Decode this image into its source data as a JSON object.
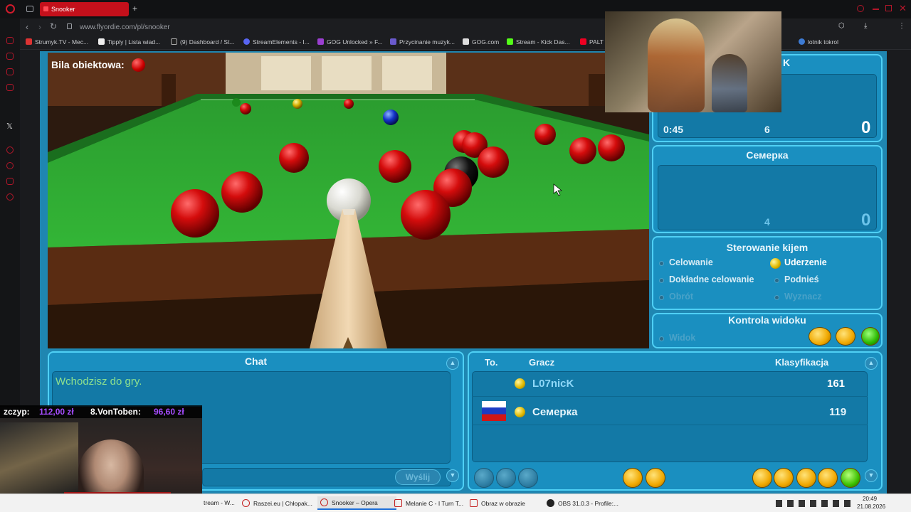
{
  "browser": {
    "tab_title": "Snooker",
    "new_tab": "+",
    "url": "www.flyordie.com/pl/snooker",
    "bookmarks": [
      "Strumyk.TV - Mec...",
      "Tipply | Lista wiad...",
      "(9) Dashboard / St...",
      "StreamElements - I...",
      "GOG Unlocked » F...",
      "Przycinanie muzyk...",
      "GOG.com",
      "Stream - Kick Das...",
      "PALT",
      "lotnik tokrol"
    ]
  },
  "game": {
    "object_ball_label": "Bila obiektowa:",
    "player1_panel": {
      "time": "0:45",
      "count": "6",
      "score": "0",
      "name_fragment": "K"
    },
    "player2_panel": {
      "name": "Семерка",
      "count": "4",
      "score": "0"
    },
    "cue_control": {
      "title": "Sterowanie kijem",
      "options": [
        "Celowanie",
        "Uderzenie",
        "Dokładne celowanie",
        "Podnieś",
        "Obrót",
        "Wyznacz"
      ],
      "selected": "Uderzenie"
    },
    "view_control": {
      "title": "Kontrola widoku",
      "option": "Widok"
    },
    "chat": {
      "title": "Chat",
      "message": "Wchodzisz do gry.",
      "send_label": "Wyślij"
    },
    "players_table": {
      "headers": [
        "To.",
        "Gracz",
        "Klasyfikacja"
      ],
      "rows": [
        {
          "name": "L07nicK",
          "rating": "161"
        },
        {
          "name": "Семерка",
          "rating": "119"
        }
      ]
    }
  },
  "stream_overlay": {
    "donation1": "zczyp:",
    "donation1_amount": "112,00 zł",
    "donation2": "8.VonToben:",
    "donation2_amount": "96,60 zł"
  },
  "taskbar": {
    "items": [
      "tream - W...",
      "Raszei.eu | Chłopak...",
      "Snooker – Opera",
      "Melanie C - I Turn T...",
      "Obraz w obrazie",
      "OBS 31.0.3 - Profile:..."
    ],
    "time": "20:49",
    "date": "21.08.2026"
  },
  "colors": {
    "accent": "#c4101b",
    "panel": "#1a8fc0",
    "felt": "#2fa832"
  }
}
